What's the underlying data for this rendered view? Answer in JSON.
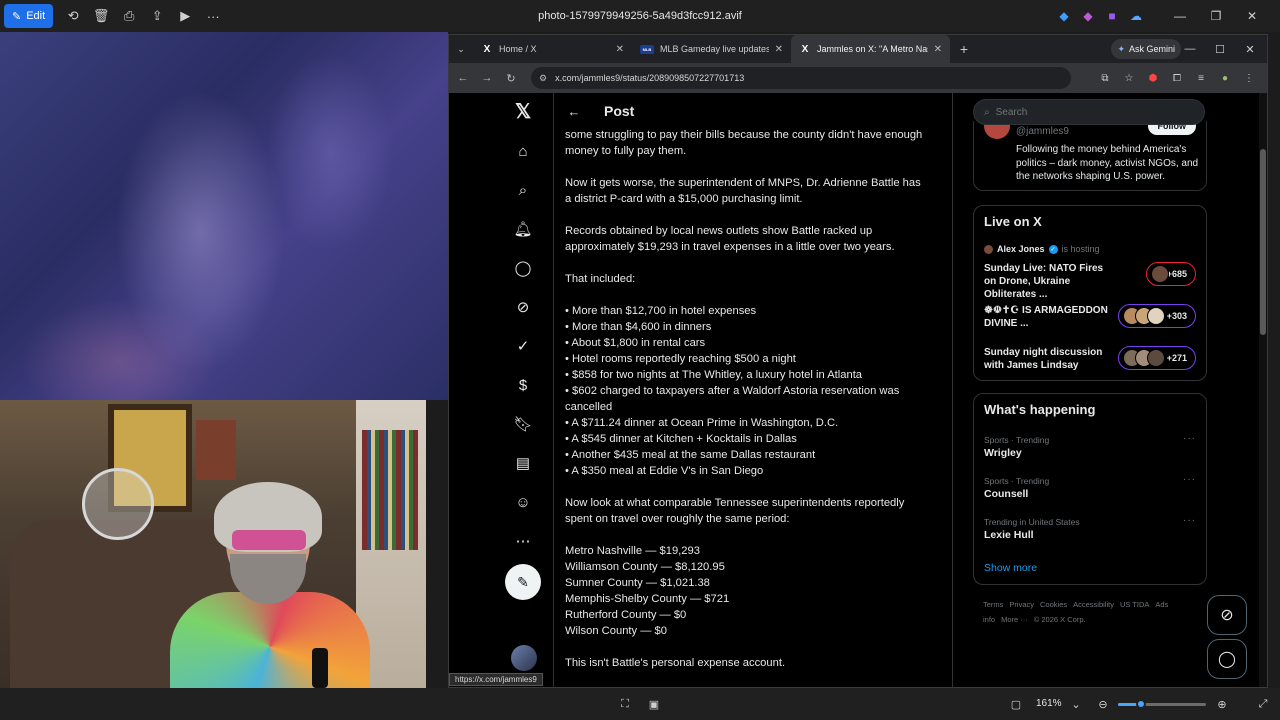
{
  "viewer": {
    "edit_label": "Edit",
    "title": "photo-1579979949256-5a49d3fcc912.avif",
    "zoom": "161%",
    "zoom_fraction": 0.26
  },
  "status_url": "https://x.com/jammles9",
  "browser": {
    "tabs": [
      {
        "title": "Home / X",
        "favicon": "X"
      },
      {
        "title": "MLB Gameday live updates: Ca",
        "favicon": "MLB"
      },
      {
        "title": "Jammles on X: \"A Metro Nashv",
        "favicon": "X"
      }
    ],
    "gemini_label": "Ask Gemini",
    "url": "x.com/jammles9/status/2089098507227701713"
  },
  "x": {
    "header_title": "Post",
    "post_lines": [
      "some struggling to pay their bills because the county didn't have enough",
      "money to fully pay them.",
      "",
      "Now it gets worse, the superintendent of MNPS, Dr. Adrienne Battle has",
      "a district P-card with a $15,000 purchasing limit.",
      "",
      "Records obtained by local news outlets show Battle racked up",
      "approximately $19,293 in travel expenses in a little over two years.",
      "",
      "That included:",
      "",
      "• More than $12,700 in hotel expenses",
      "• More than $4,600 in dinners",
      "• About $1,800 in rental cars",
      "• Hotel rooms reportedly reaching $500 a night",
      "• $858 for two nights at The Whitley, a luxury hotel in Atlanta",
      "• $602 charged to taxpayers after a Waldorf Astoria reservation was",
      "cancelled",
      "• A $711.24 dinner at Ocean Prime in Washington, D.C.",
      "• A $545 dinner at Kitchen + Kocktails in Dallas",
      "• Another $435 meal at the same Dallas restaurant",
      "• A $350 meal at Eddie V's in San Diego",
      "",
      "Now look at what comparable Tennessee superintendents reportedly",
      "spent on travel over roughly the same period:",
      "",
      "Metro Nashville — $19,293",
      "Williamson County — $8,120.95",
      "Sumner County — $1,021.38",
      "Memphis-Shelby County — $721",
      "Rutherford County — $0",
      "Wilson County — $0",
      "",
      "This isn't Battle's personal expense account."
    ],
    "search_placeholder": "Search",
    "profile": {
      "handle": "@jammles9",
      "follow_label": "Follow",
      "bio": "Following the money behind America's politics – dark money, activist NGOs, and the networks shaping U.S. power."
    },
    "live": {
      "title": "Live on X",
      "host_name": "Alex Jones",
      "host_suffix": "is hosting",
      "items": [
        {
          "title": "Sunday Live: NATO Fires on Drone, Ukraine Obliterates ...",
          "count": "+685",
          "accent": "#f4212e"
        },
        {
          "title": "☸☫✝☪ IS ARMAGEDDON DIVINE ...",
          "count": "+303",
          "accent": "#7b3ff2"
        },
        {
          "title": "Sunday night discussion with James Lindsay",
          "count": "+271",
          "accent": "#7b3ff2"
        }
      ]
    },
    "happening": {
      "title": "What's happening",
      "trends": [
        {
          "meta": "Sports · Trending",
          "name": "Wrigley"
        },
        {
          "meta": "Sports · Trending",
          "name": "Counsell"
        },
        {
          "meta": "Trending in United States",
          "name": "Lexie Hull"
        }
      ],
      "show_more": "Show more"
    },
    "footer": [
      "Terms",
      "Privacy",
      "Cookies",
      "Accessibility",
      "US TIDA",
      "Ads info",
      "More ···",
      "© 2026 X Corp."
    ]
  }
}
